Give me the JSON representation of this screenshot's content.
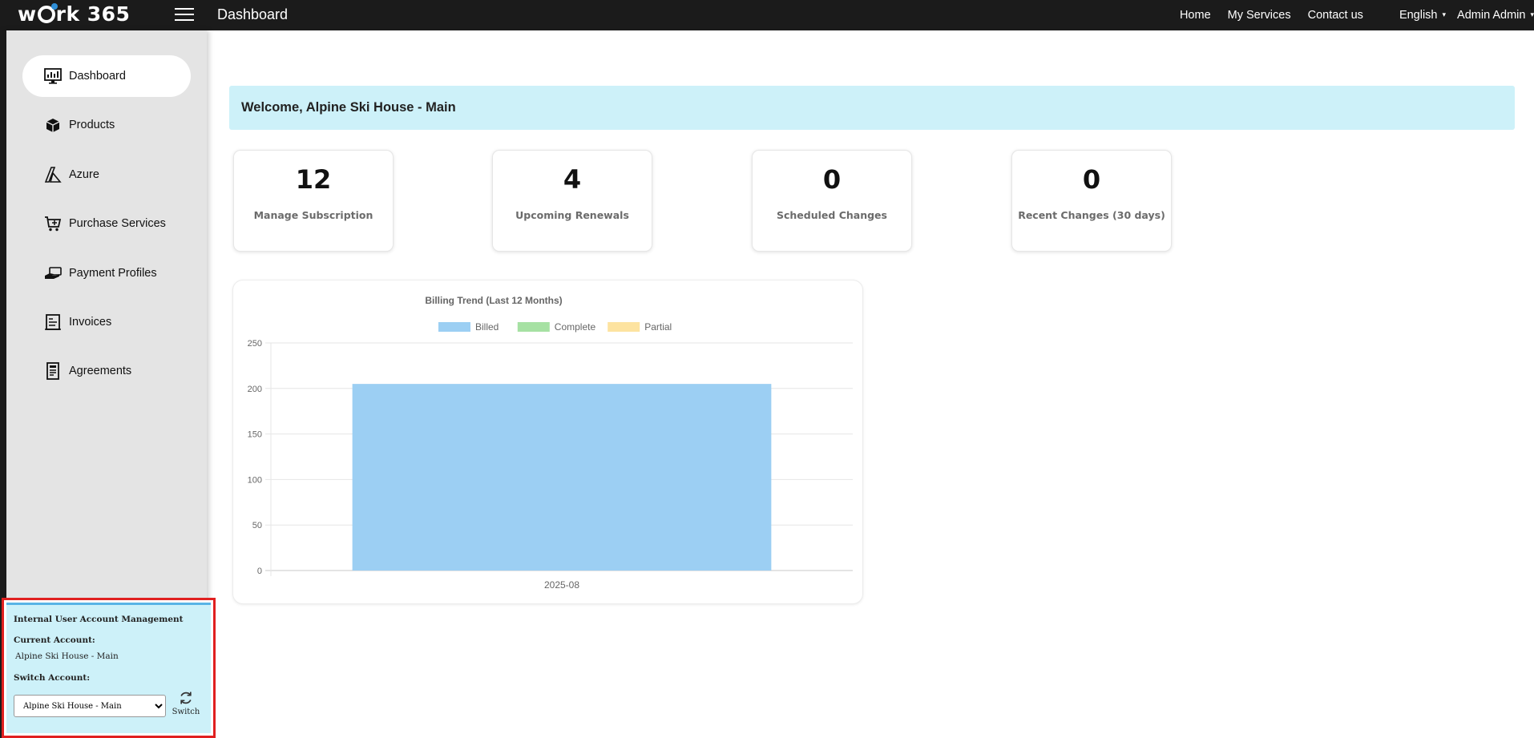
{
  "topbar": {
    "logo_text": "work365",
    "page_title": "Dashboard",
    "nav": [
      {
        "label": "Home"
      },
      {
        "label": "My Services"
      },
      {
        "label": "Contact us"
      }
    ],
    "language": "English",
    "user": "Admin Admin"
  },
  "sidebar": {
    "items": [
      {
        "label": "Dashboard",
        "icon": "dashboard-icon",
        "active": true
      },
      {
        "label": "Products",
        "icon": "products-icon"
      },
      {
        "label": "Azure",
        "icon": "azure-icon"
      },
      {
        "label": "Purchase Services",
        "icon": "cart-icon"
      },
      {
        "label": "Payment Profiles",
        "icon": "payment-icon"
      },
      {
        "label": "Invoices",
        "icon": "invoice-icon"
      },
      {
        "label": "Agreements",
        "icon": "agreement-icon"
      }
    ],
    "account": {
      "title": "Internal User Account Management",
      "current_label": "Current Account:",
      "current_value": "Alpine Ski House - Main",
      "switch_label": "Switch Account:",
      "selected_option": "Alpine Ski House - Main",
      "switch_button": "Switch"
    }
  },
  "main": {
    "welcome": "Welcome, Alpine Ski House - Main",
    "cards": [
      {
        "value": "12",
        "label": "Manage Subscription"
      },
      {
        "value": "4",
        "label": "Upcoming Renewals"
      },
      {
        "value": "0",
        "label": "Scheduled Changes"
      },
      {
        "value": "0",
        "label": "Recent Changes (30 days)"
      }
    ]
  },
  "chart_data": {
    "type": "bar",
    "title": "Billing Trend (Last 12 Months)",
    "categories": [
      "2025-08"
    ],
    "series": [
      {
        "name": "Billed",
        "values": [
          205
        ],
        "color": "#9ccff3"
      },
      {
        "name": "Complete",
        "values": [
          0
        ],
        "color": "#a6e1a3"
      },
      {
        "name": "Partial",
        "values": [
          0
        ],
        "color": "#fde3a0"
      }
    ],
    "ylim": [
      0,
      250
    ],
    "yticks": [
      0,
      50,
      100,
      150,
      200,
      250
    ],
    "grid": true,
    "legend": "top"
  }
}
